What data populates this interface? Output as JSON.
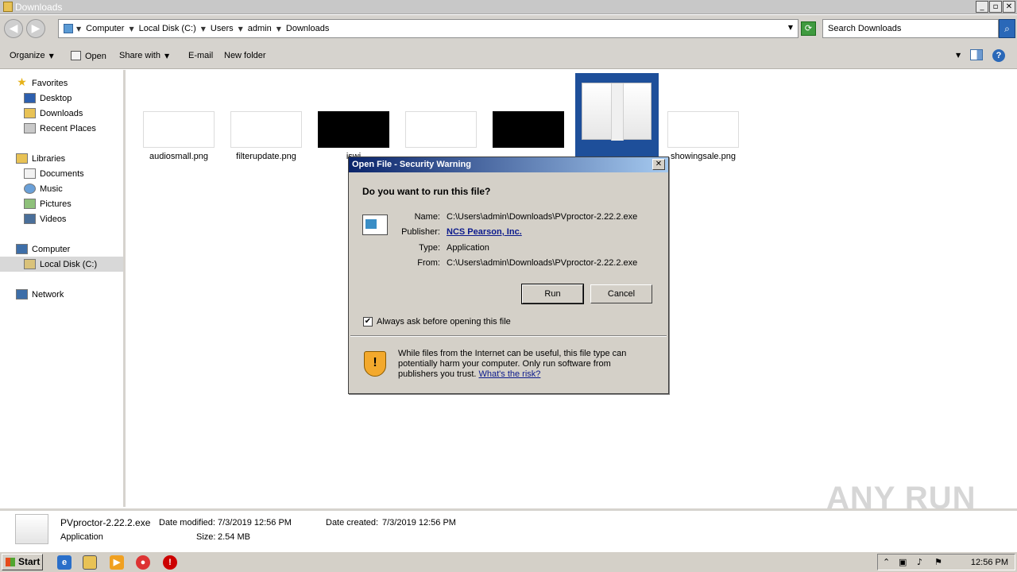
{
  "window": {
    "title": "Downloads"
  },
  "breadcrumbs": [
    "Computer",
    "Local Disk (C:)",
    "Users",
    "admin",
    "Downloads"
  ],
  "search": {
    "placeholder": "Search Downloads"
  },
  "toolbar": {
    "organize": "Organize",
    "open": "Open",
    "share_with": "Share with",
    "email": "E-mail",
    "new_folder": "New folder"
  },
  "sidebar": {
    "favorites": {
      "label": "Favorites",
      "items": [
        "Desktop",
        "Downloads",
        "Recent Places"
      ]
    },
    "libraries": {
      "label": "Libraries",
      "items": [
        "Documents",
        "Music",
        "Pictures",
        "Videos"
      ]
    },
    "computer": {
      "label": "Computer",
      "items": [
        "Local Disk (C:)"
      ]
    },
    "network": {
      "label": "Network"
    }
  },
  "files": [
    {
      "name": "audiosmall.png",
      "thumb": "light"
    },
    {
      "name": "filterupdate.png",
      "thumb": "light"
    },
    {
      "name": "iswi",
      "thumb": "dark"
    },
    {
      "name": "",
      "thumb": "light"
    },
    {
      "name": "",
      "thumb": "dark"
    },
    {
      "name": "showingsale.png",
      "thumb": "light"
    }
  ],
  "dialog": {
    "title": "Open File - Security Warning",
    "question": "Do you want to run this file?",
    "labels": {
      "name": "Name:",
      "publisher": "Publisher:",
      "type": "Type:",
      "from": "From:"
    },
    "values": {
      "name": "C:\\Users\\admin\\Downloads\\PVproctor-2.22.2.exe",
      "publisher": "NCS Pearson, Inc.",
      "type": "Application",
      "from": "C:\\Users\\admin\\Downloads\\PVproctor-2.22.2.exe"
    },
    "run": "Run",
    "cancel": "Cancel",
    "checkbox": {
      "label": "Always ask before opening this file",
      "checked": true
    },
    "warning": "While files from the Internet can be useful, this file type can potentially harm your computer. Only run software from publishers you trust.",
    "risk_link": "What's the risk?"
  },
  "details": {
    "filename": "PVproctor-2.22.2.exe",
    "type": "Application",
    "modified_label": "Date modified:",
    "modified": "7/3/2019 12:56 PM",
    "created_label": "Date created:",
    "created": "7/3/2019 12:56 PM",
    "size_label": "Size:",
    "size": "2.54 MB"
  },
  "watermark": "ANY RUN",
  "taskbar": {
    "start": "Start",
    "clock": "12:56 PM"
  }
}
